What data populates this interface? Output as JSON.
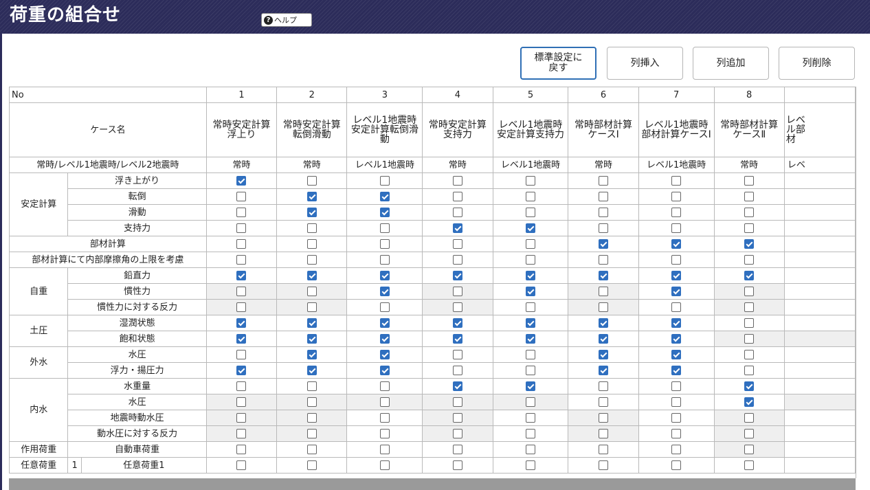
{
  "window": {
    "title": "荷重の組合せ",
    "help_label": "ヘルプ"
  },
  "toolbar": {
    "reset_label": "標準設定に\n戻す",
    "insert_label": "列挿入",
    "add_label": "列追加",
    "delete_label": "列削除"
  },
  "grid": {
    "no_label": "No",
    "case_name_label": "ケース名",
    "type_label": "常時/レベル1地震時/レベル2地震時",
    "columns": [
      {
        "no": "1",
        "name": "常時安定計算浮上り",
        "type": "常時"
      },
      {
        "no": "2",
        "name": "常時安定計算転倒滑動",
        "type": "常時"
      },
      {
        "no": "3",
        "name": "レベル1地震時安定計算転倒滑動",
        "type": "レベル1地震時"
      },
      {
        "no": "4",
        "name": "常時安定計算支持力",
        "type": "常時"
      },
      {
        "no": "5",
        "name": "レベル1地震時安定計算支持力",
        "type": "レベル1地震時"
      },
      {
        "no": "6",
        "name": "常時部材計算ケースⅠ",
        "type": "常時"
      },
      {
        "no": "7",
        "name": "レベル1地震時部材計算ケースⅠ",
        "type": "レベル1地震時"
      },
      {
        "no": "8",
        "name": "常時部材計算ケースⅡ",
        "type": "常時"
      },
      {
        "no": "",
        "name": "レベル部材",
        "type": "レベ"
      }
    ],
    "groups": {
      "stability": "安定計算",
      "member": "部材計算",
      "friction": "部材計算にて内部摩擦角の上限を考慮",
      "self_weight": "自重",
      "earth_pressure": "土圧",
      "outer_water": "外水",
      "inner_water": "内水",
      "action_load": "作用荷重",
      "optional_load": "任意荷重",
      "optional_index": "1"
    },
    "rows": [
      {
        "label": "浮き上がり",
        "values": [
          1,
          0,
          0,
          0,
          0,
          0,
          0,
          0
        ],
        "gray": [
          0,
          0,
          0,
          0,
          0,
          0,
          0,
          0
        ]
      },
      {
        "label": "転倒",
        "values": [
          0,
          1,
          1,
          0,
          0,
          0,
          0,
          0
        ],
        "gray": [
          0,
          0,
          0,
          0,
          0,
          0,
          0,
          0
        ]
      },
      {
        "label": "滑動",
        "values": [
          0,
          1,
          1,
          0,
          0,
          0,
          0,
          0
        ],
        "gray": [
          0,
          0,
          0,
          0,
          0,
          0,
          0,
          0
        ]
      },
      {
        "label": "支持力",
        "values": [
          0,
          0,
          0,
          1,
          1,
          0,
          0,
          0
        ],
        "gray": [
          0,
          0,
          0,
          0,
          0,
          0,
          0,
          0
        ]
      },
      {
        "label": "部材計算",
        "values": [
          0,
          0,
          0,
          0,
          0,
          1,
          1,
          1
        ],
        "gray": [
          0,
          0,
          0,
          0,
          0,
          0,
          0,
          0
        ]
      },
      {
        "label": "部材計算にて内部摩擦角の上限を考慮",
        "values": [
          0,
          0,
          0,
          0,
          0,
          0,
          0,
          0
        ],
        "gray": [
          0,
          0,
          0,
          0,
          0,
          0,
          0,
          0
        ]
      },
      {
        "label": "鉛直力",
        "values": [
          1,
          1,
          1,
          1,
          1,
          1,
          1,
          1
        ],
        "gray": [
          0,
          0,
          0,
          0,
          0,
          0,
          0,
          0
        ]
      },
      {
        "label": "慣性力",
        "values": [
          0,
          0,
          1,
          0,
          1,
          0,
          1,
          0
        ],
        "gray": [
          1,
          1,
          0,
          1,
          0,
          1,
          0,
          1
        ]
      },
      {
        "label": "慣性力に対する反力",
        "values": [
          0,
          0,
          0,
          0,
          0,
          0,
          0,
          0
        ],
        "gray": [
          1,
          1,
          0,
          1,
          0,
          1,
          0,
          1
        ]
      },
      {
        "label": "湿潤状態",
        "values": [
          1,
          1,
          1,
          1,
          1,
          1,
          1,
          0
        ],
        "gray": [
          0,
          0,
          0,
          0,
          0,
          0,
          0,
          0
        ]
      },
      {
        "label": "飽和状態",
        "values": [
          1,
          1,
          1,
          1,
          1,
          1,
          1,
          0
        ],
        "gray": [
          0,
          0,
          0,
          0,
          0,
          0,
          0,
          1
        ]
      },
      {
        "label": "水圧",
        "values": [
          0,
          1,
          1,
          0,
          0,
          1,
          1,
          0
        ],
        "gray": [
          0,
          0,
          0,
          0,
          0,
          0,
          0,
          0
        ]
      },
      {
        "label": "浮力・揚圧力",
        "values": [
          1,
          1,
          1,
          0,
          0,
          1,
          1,
          0
        ],
        "gray": [
          0,
          0,
          0,
          0,
          0,
          0,
          0,
          0
        ]
      },
      {
        "label": "水重量",
        "values": [
          0,
          0,
          0,
          1,
          1,
          0,
          0,
          1
        ],
        "gray": [
          0,
          0,
          0,
          0,
          0,
          0,
          0,
          0
        ]
      },
      {
        "label": "水圧",
        "values": [
          0,
          0,
          0,
          0,
          0,
          0,
          0,
          1
        ],
        "gray": [
          1,
          1,
          1,
          1,
          1,
          0,
          0,
          0
        ]
      },
      {
        "label": "地震時動水圧",
        "values": [
          0,
          0,
          0,
          0,
          0,
          0,
          0,
          0
        ],
        "gray": [
          1,
          1,
          0,
          1,
          0,
          1,
          0,
          1
        ]
      },
      {
        "label": "動水圧に対する反力",
        "values": [
          0,
          0,
          0,
          0,
          0,
          0,
          0,
          0
        ],
        "gray": [
          1,
          1,
          0,
          1,
          0,
          1,
          0,
          1
        ]
      },
      {
        "label": "自動車荷重",
        "values": [
          0,
          0,
          0,
          0,
          0,
          0,
          0,
          0
        ],
        "gray": [
          0,
          0,
          0,
          0,
          0,
          0,
          0,
          1
        ]
      },
      {
        "label": "任意荷重1",
        "values": [
          0,
          0,
          0,
          0,
          0,
          0,
          0,
          0
        ],
        "gray": [
          0,
          0,
          0,
          0,
          0,
          0,
          0,
          0
        ]
      }
    ]
  },
  "colors": {
    "title_bg": "#2c2c5a",
    "check_on": "#2f6fbf",
    "gray_cell": "#efefef"
  }
}
